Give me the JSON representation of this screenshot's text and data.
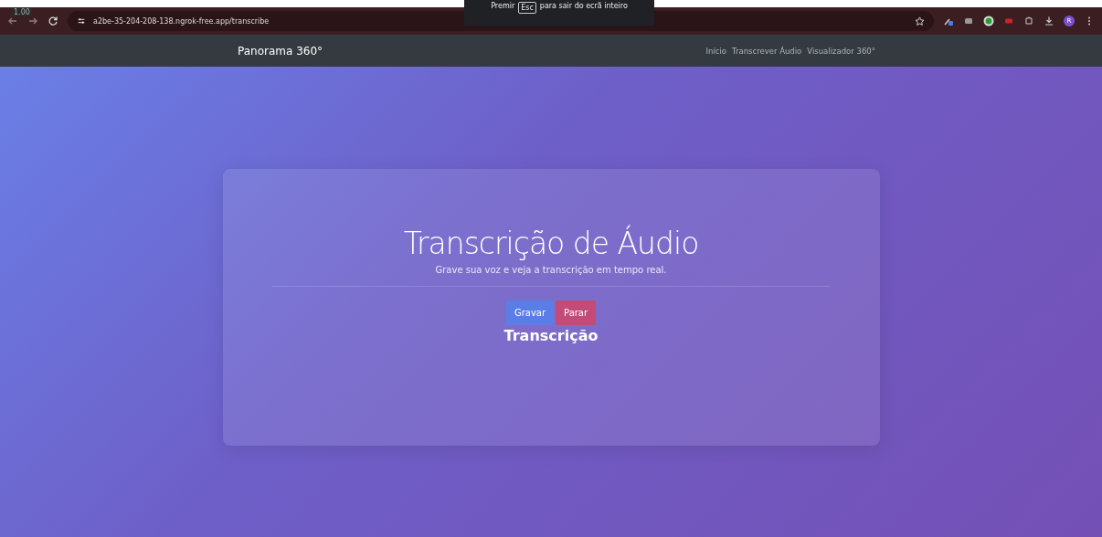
{
  "browser": {
    "zoom": "1.00",
    "url": "a2be-35-204-208-138.ngrok-free.app/transcribe",
    "avatar": "R"
  },
  "fullscreen_notice": {
    "before": "Premir",
    "key": "Esc",
    "after": "para sair do ecrã inteiro"
  },
  "navbar": {
    "brand": "Panorama 360°",
    "links": [
      "Início",
      "Transcrever Áudio",
      "Visualizador 360°"
    ]
  },
  "card": {
    "title": "Transcrição de Áudio",
    "subtitle": "Grave sua voz e veja a transcrição em tempo real.",
    "buttons": [
      {
        "label": "Gravar",
        "kind": "primary"
      },
      {
        "label": "Parar",
        "kind": "danger"
      }
    ],
    "section_title": "Transcrição"
  }
}
